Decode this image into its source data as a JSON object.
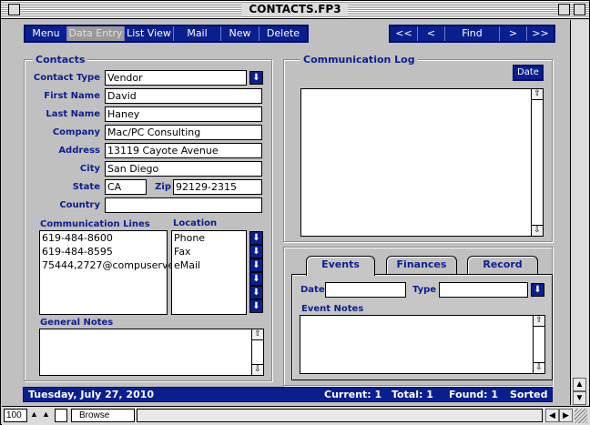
{
  "window": {
    "title": "CONTACTS.FP3"
  },
  "nav_left": [
    {
      "label": "Menu",
      "active": false
    },
    {
      "label": "Data Entry",
      "active": true
    },
    {
      "label": "List View",
      "active": false
    },
    {
      "label": "Mail",
      "active": false
    },
    {
      "label": "New",
      "active": false
    },
    {
      "label": "Delete",
      "active": false
    }
  ],
  "nav_right": [
    {
      "label": "<<"
    },
    {
      "label": "<"
    },
    {
      "label": "Find"
    },
    {
      "label": ">"
    },
    {
      "label": ">>"
    }
  ],
  "contacts": {
    "group_label": "Contacts",
    "contact_type_label": "Contact Type",
    "contact_type": "Vendor",
    "first_name_label": "First Name",
    "first_name": "David",
    "last_name_label": "Last Name",
    "last_name": "Haney",
    "company_label": "Company",
    "company": "Mac/PC Consulting",
    "address_label": "Address",
    "address": "13119 Cayote Avenue",
    "city_label": "City",
    "city": "San Diego",
    "state_label": "State",
    "state": "CA",
    "zip_label": "Zip",
    "zip": "92129-2315",
    "country_label": "Country",
    "country": "",
    "comm_lines_label": "Communication Lines",
    "location_label": "Location",
    "comm_lines": [
      "619-484-8600",
      "619-484-8595",
      "75444,2727@compuserve"
    ],
    "locations": [
      "Phone",
      "Fax",
      "eMail"
    ],
    "general_notes_label": "General Notes"
  },
  "comm_log": {
    "group_label": "Communication Log",
    "date_button": "Date"
  },
  "tabs": [
    {
      "label": "Events",
      "active": true
    },
    {
      "label": "Finances",
      "active": false
    },
    {
      "label": "Record",
      "active": false
    }
  ],
  "events": {
    "date_label": "Date",
    "type_label": "Type",
    "event_notes_label": "Event Notes"
  },
  "status": {
    "date": "Tuesday, July 27, 2010",
    "current": "Current: 1",
    "total": "Total: 1",
    "found": "Found: 1",
    "sort": "Sorted"
  },
  "bottom": {
    "zoom": "100",
    "mode": "Browse"
  },
  "icons": {
    "dropdown": "down-arrow-icon",
    "scroll_up": "up-arrow-icon",
    "scroll_down": "down-arrow-icon"
  },
  "colors": {
    "accent": "#0a1f8f",
    "background": "#c0c0c0"
  }
}
